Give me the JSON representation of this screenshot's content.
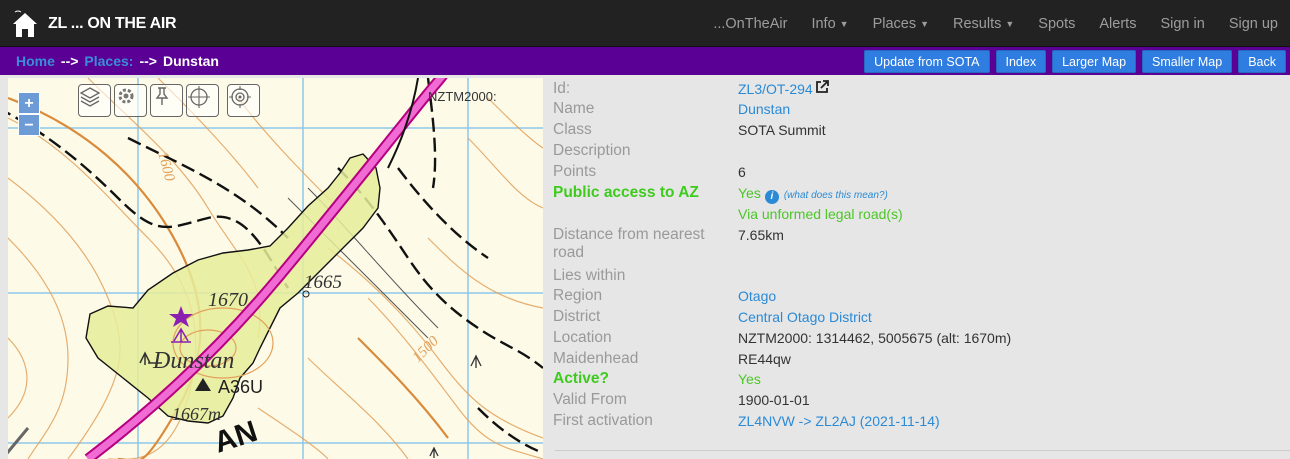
{
  "navbar": {
    "brand": "ZL ... ON THE AIR",
    "links": [
      {
        "label": "...OnTheAir",
        "caret": false
      },
      {
        "label": "Info",
        "caret": true
      },
      {
        "label": "Places",
        "caret": true
      },
      {
        "label": "Results",
        "caret": true
      },
      {
        "label": "Spots",
        "caret": false
      },
      {
        "label": "Alerts",
        "caret": false
      },
      {
        "label": "Sign in",
        "caret": false
      },
      {
        "label": "Sign up",
        "caret": false
      }
    ]
  },
  "breadcrumb": {
    "home": "Home",
    "places": "Places:",
    "arrow": "-->",
    "current": "Dunstan"
  },
  "actions": {
    "update": "Update from SOTA",
    "index": "Index",
    "larger": "Larger Map",
    "smaller": "Smaller Map",
    "back": "Back"
  },
  "map": {
    "zoom_in": "+",
    "zoom_out": "−",
    "crs_label": "NZTM2000:",
    "labels": {
      "c1600": "1600",
      "c1665": "1665",
      "c1670": "1670",
      "c1500": "1500",
      "place": "Dunstan",
      "trig": "A36U",
      "c1667": "1667m",
      "an": "AN"
    }
  },
  "details": {
    "id_label": "Id:",
    "id_value": "ZL3/OT-294",
    "name_label": "Name",
    "name_value": "Dunstan",
    "class_label": "Class",
    "class_value": "SOTA Summit",
    "description_label": "Description",
    "points_label": "Points",
    "points_value": "6",
    "public_label": "Public access to AZ",
    "public_value": "Yes",
    "public_help": "(what does this mean?)",
    "public_note": "Via unformed legal road(s)",
    "distance_label": "Distance from nearest road",
    "distance_value": "7.65km",
    "lies_label": "Lies within",
    "region_label": "Region",
    "region_value": "Otago",
    "district_label": "District",
    "district_value": "Central Otago District",
    "location_label": "Location",
    "location_value": "NZTM2000: 1314462, 5005675 (alt: 1670m)",
    "maidenhead_label": "Maidenhead",
    "maidenhead_value": "RE44qw",
    "active_label": "Active?",
    "active_value": "Yes",
    "valid_label": "Valid From",
    "valid_value": "1900-01-01",
    "first_label": "First activation",
    "first_value": "ZL4NVW -> ZL2AJ (2021-11-14)"
  }
}
